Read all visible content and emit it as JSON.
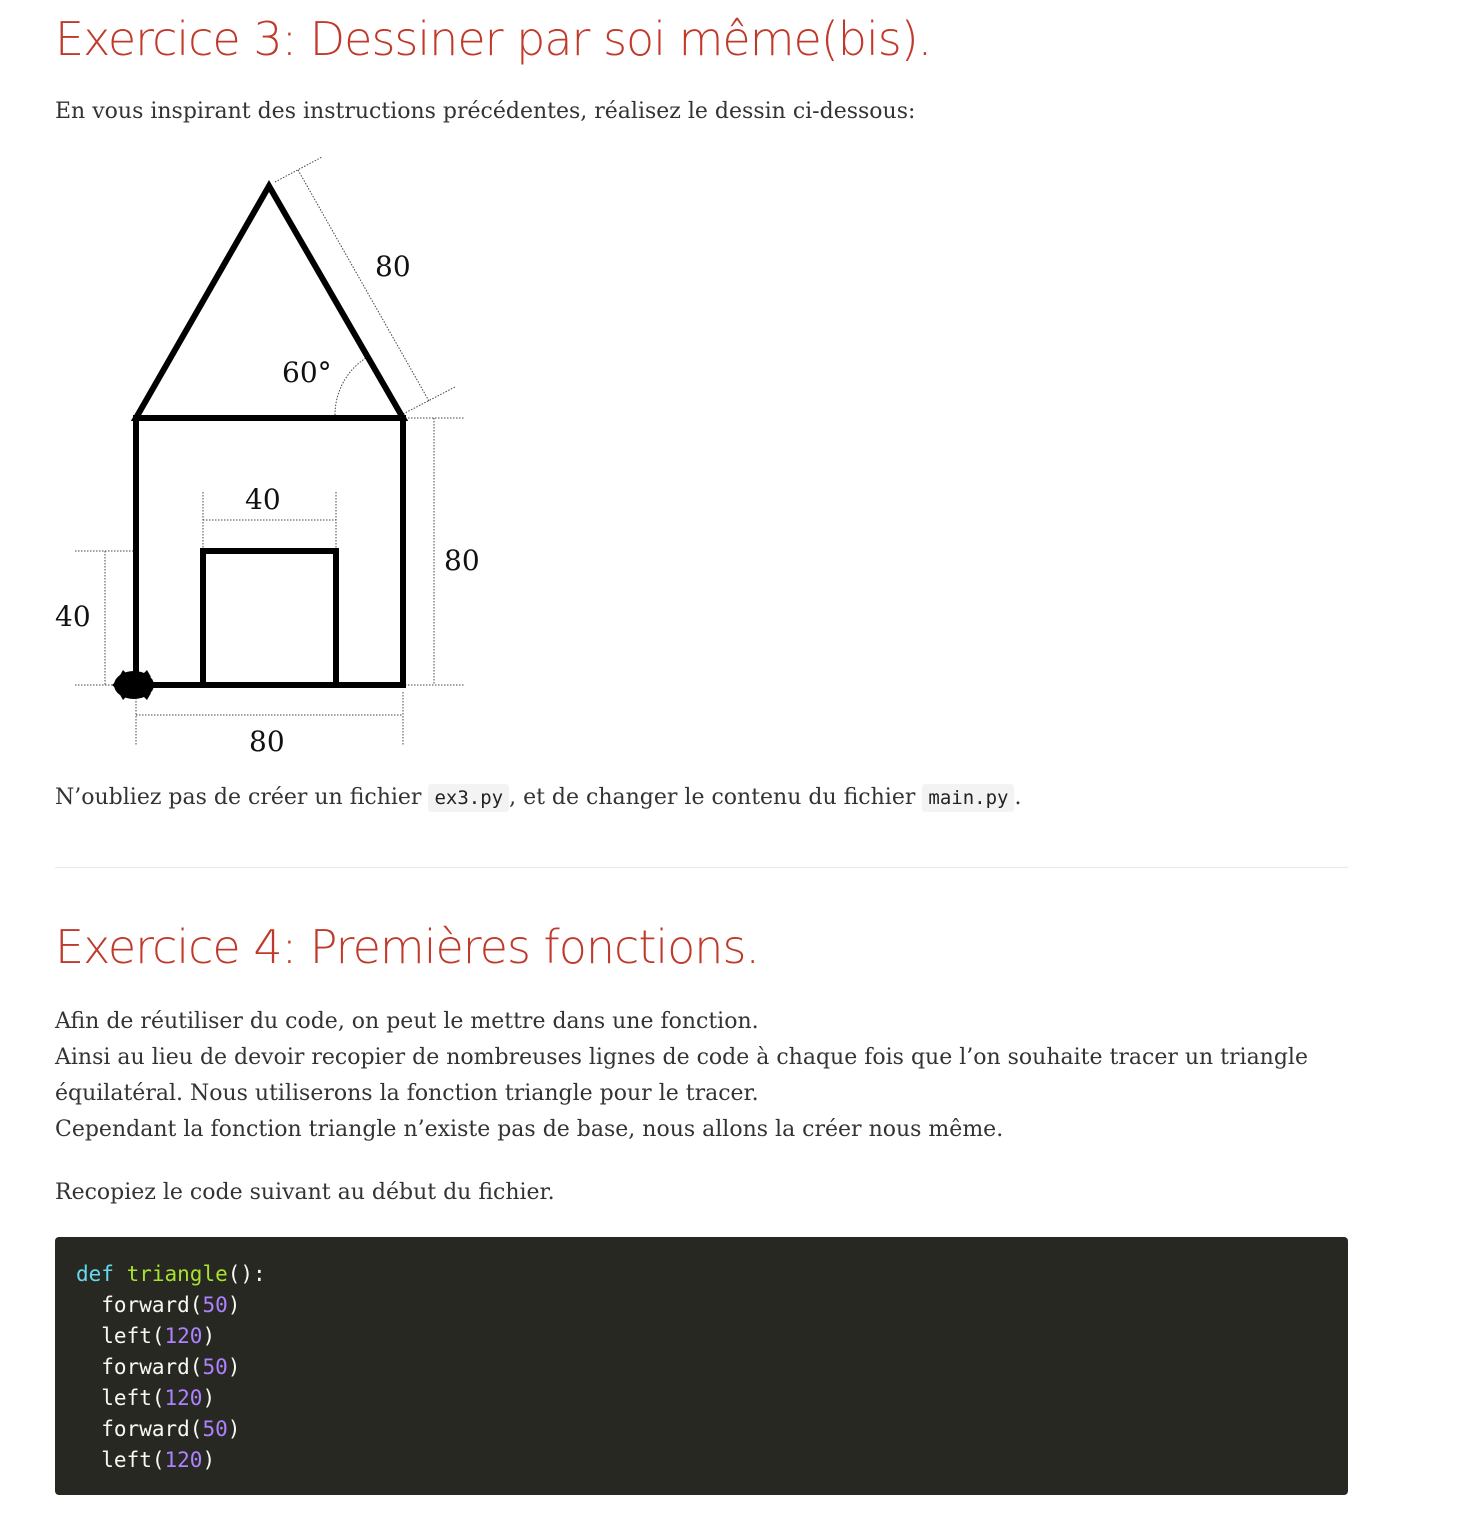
{
  "ex3": {
    "title": "Exercice 3: Dessiner par soi même(bis).",
    "intro": "En vous inspirant des instructions précédentes, réalisez le dessin ci-dessous:",
    "figure": {
      "roof_side_label": "80",
      "roof_angle_label": "60°",
      "wall_height_label": "80",
      "door_width_label": "40",
      "door_height_label": "40",
      "base_width_label": "80"
    },
    "note_before": "N’oubliez pas de créer un fichier ",
    "note_file1": "ex3.py",
    "note_middle": ", et de changer le contenu du fichier ",
    "note_file2": "main.py",
    "note_after": "."
  },
  "ex4": {
    "title": "Exercice 4: Premières fonctions.",
    "para_line1": "Afin de réutiliser du code, on peut le mettre dans une fonction.",
    "para_line2": "Ainsi au lieu de devoir recopier de nombreuses lignes de code à chaque fois que l’on souhaite tracer un triangle",
    "para_line3": "équilatéral. Nous utiliserons la fonction triangle pour le tracer.",
    "para_line4": "Cependant la fonction triangle n’existe pas de base, nous allons la créer nous même.",
    "instruction": "Recopiez le code suivant au début du fichier.",
    "code": {
      "def_kw": "def",
      "fn_name": "triangle",
      "def_tail": "():",
      "lines": [
        {
          "call": "  forward(",
          "arg": "50",
          "close": ")"
        },
        {
          "call": "  left(",
          "arg": "120",
          "close": ")"
        },
        {
          "call": "  forward(",
          "arg": "50",
          "close": ")"
        },
        {
          "call": "  left(",
          "arg": "120",
          "close": ")"
        },
        {
          "call": "  forward(",
          "arg": "50",
          "close": ")"
        },
        {
          "call": "  left(",
          "arg": "120",
          "close": ")"
        }
      ]
    }
  },
  "colors": {
    "heading": "#c0392b",
    "code_bg": "#272822",
    "code_keyword": "#66d9ef",
    "code_function": "#a6e22e",
    "code_number": "#ae81ff"
  }
}
